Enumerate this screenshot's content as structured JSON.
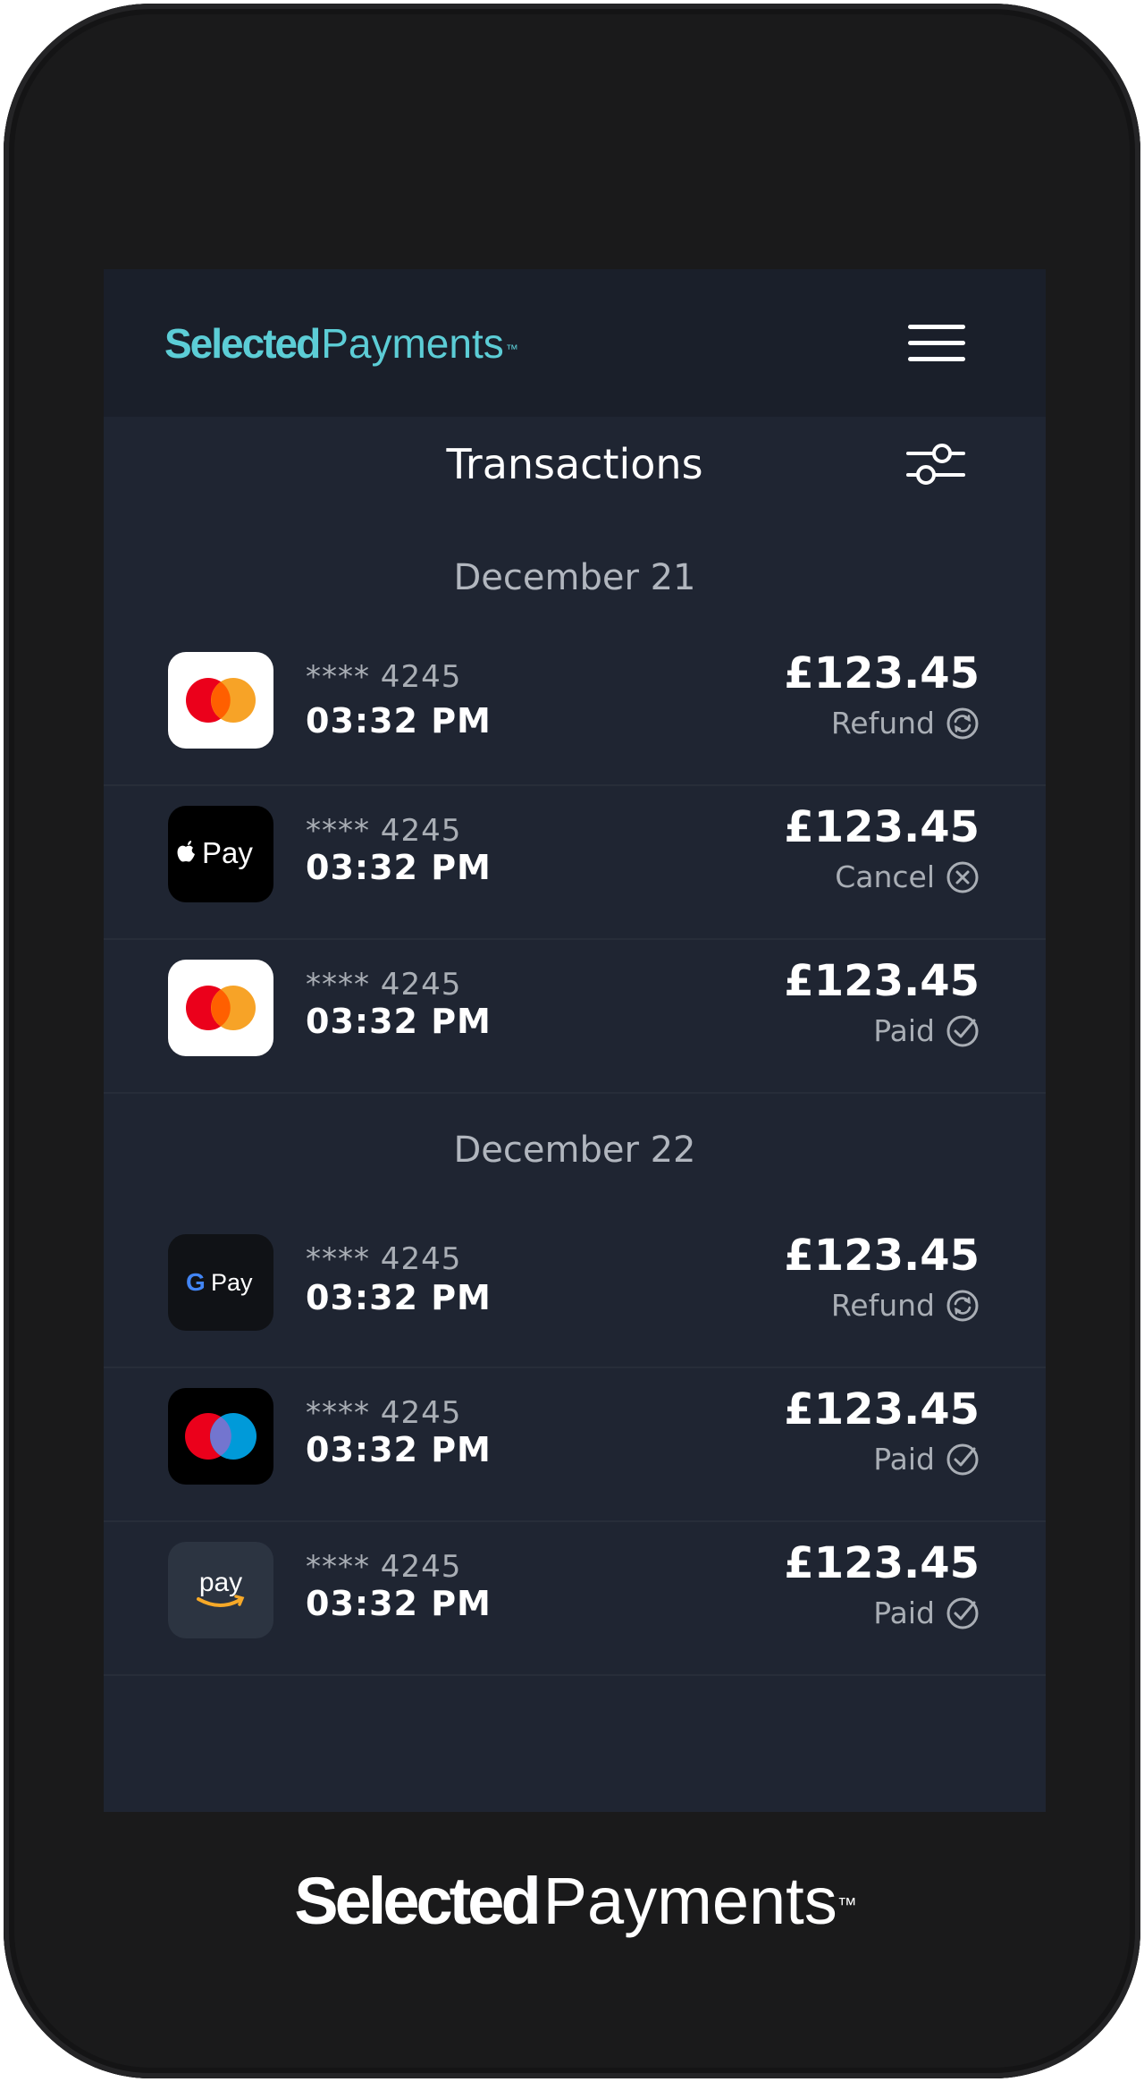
{
  "app": {
    "brand_bold": "Selected",
    "brand_light": "Payments",
    "brand_tm": "™"
  },
  "header": {
    "title": "Transactions",
    "menu_icon": "hamburger-icon",
    "filter_icon": "sliders-icon"
  },
  "groups": [
    {
      "date": "December 21",
      "items": [
        {
          "method": "Mastercard",
          "masked": "**** 4245",
          "time": "03:32 PM",
          "amount": "£123.45",
          "status": "Refund",
          "status_icon": "refund-icon"
        },
        {
          "method": "Apple Pay",
          "masked": "**** 4245",
          "time": "03:32 PM",
          "amount": "£123.45",
          "status": "Cancel",
          "status_icon": "cancel-icon"
        },
        {
          "method": "Mastercard",
          "masked": "**** 4245",
          "time": "03:32 PM",
          "amount": "£123.45",
          "status": "Paid",
          "status_icon": "check-icon"
        }
      ]
    },
    {
      "date": "December 22",
      "items": [
        {
          "method": "Google Pay",
          "masked": "**** 4245",
          "time": "03:32 PM",
          "amount": "£123.45",
          "status": "Refund",
          "status_icon": "refund-icon"
        },
        {
          "method": "Maestro",
          "masked": "**** 4245",
          "time": "03:32 PM",
          "amount": "£123.45",
          "status": "Paid",
          "status_icon": "check-icon"
        },
        {
          "method": "Amazon Pay",
          "masked": "**** 4245",
          "time": "03:32 PM",
          "amount": "£123.45",
          "status": "Paid",
          "status_icon": "check-icon"
        }
      ]
    }
  ],
  "logos": {
    "apple_pay_text": "Pay",
    "google_pay_text": "Pay",
    "amazon_pay_text": "pay"
  },
  "colors": {
    "screen_bg": "#1f2532",
    "appbar_bg": "#1a1f2a",
    "brand_accent": "#5ccdd6",
    "mastercard_red": "#eb001b",
    "mastercard_orange": "#f79e1b",
    "maestro_blue": "#00a2e5"
  }
}
